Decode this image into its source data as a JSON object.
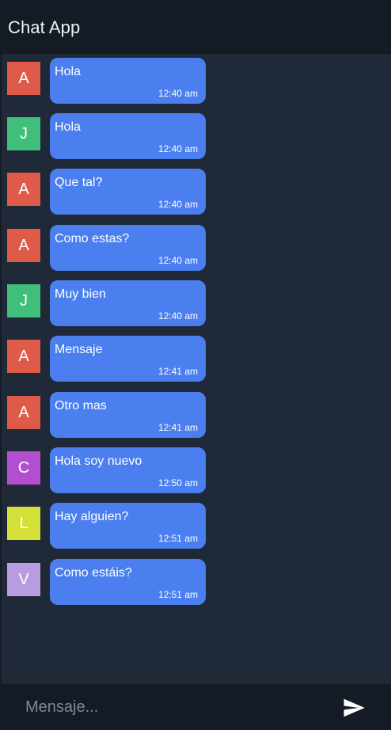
{
  "header": {
    "title": "Chat App"
  },
  "messages": [
    {
      "avatar_letter": "A",
      "avatar_color": "#e05a4a",
      "text": "Hola",
      "time": "12:40 am"
    },
    {
      "avatar_letter": "J",
      "avatar_color": "#3fbf7a",
      "text": "Hola",
      "time": "12:40 am"
    },
    {
      "avatar_letter": "A",
      "avatar_color": "#e05a4a",
      "text": "Que tal?",
      "time": "12:40 am"
    },
    {
      "avatar_letter": "A",
      "avatar_color": "#e05a4a",
      "text": "Como estas?",
      "time": "12:40 am"
    },
    {
      "avatar_letter": "J",
      "avatar_color": "#3fbf7a",
      "text": "Muy bien",
      "time": "12:40 am"
    },
    {
      "avatar_letter": "A",
      "avatar_color": "#e05a4a",
      "text": "Mensaje",
      "time": "12:41 am"
    },
    {
      "avatar_letter": "A",
      "avatar_color": "#e05a4a",
      "text": "Otro mas",
      "time": "12:41 am"
    },
    {
      "avatar_letter": "C",
      "avatar_color": "#b24fd1",
      "text": "Hola soy nuevo",
      "time": "12:50 am"
    },
    {
      "avatar_letter": "L",
      "avatar_color": "#d4e03a",
      "text": "Hay alguien?",
      "time": "12:51 am"
    },
    {
      "avatar_letter": "V",
      "avatar_color": "#b89ce0",
      "text": "Como estáis?",
      "time": "12:51 am"
    }
  ],
  "composer": {
    "placeholder": "Mensaje...",
    "value": "",
    "send_icon": "send-icon"
  },
  "colors": {
    "bubble": "#4b7ff0",
    "background": "#1f2937",
    "header": "#141b24"
  }
}
